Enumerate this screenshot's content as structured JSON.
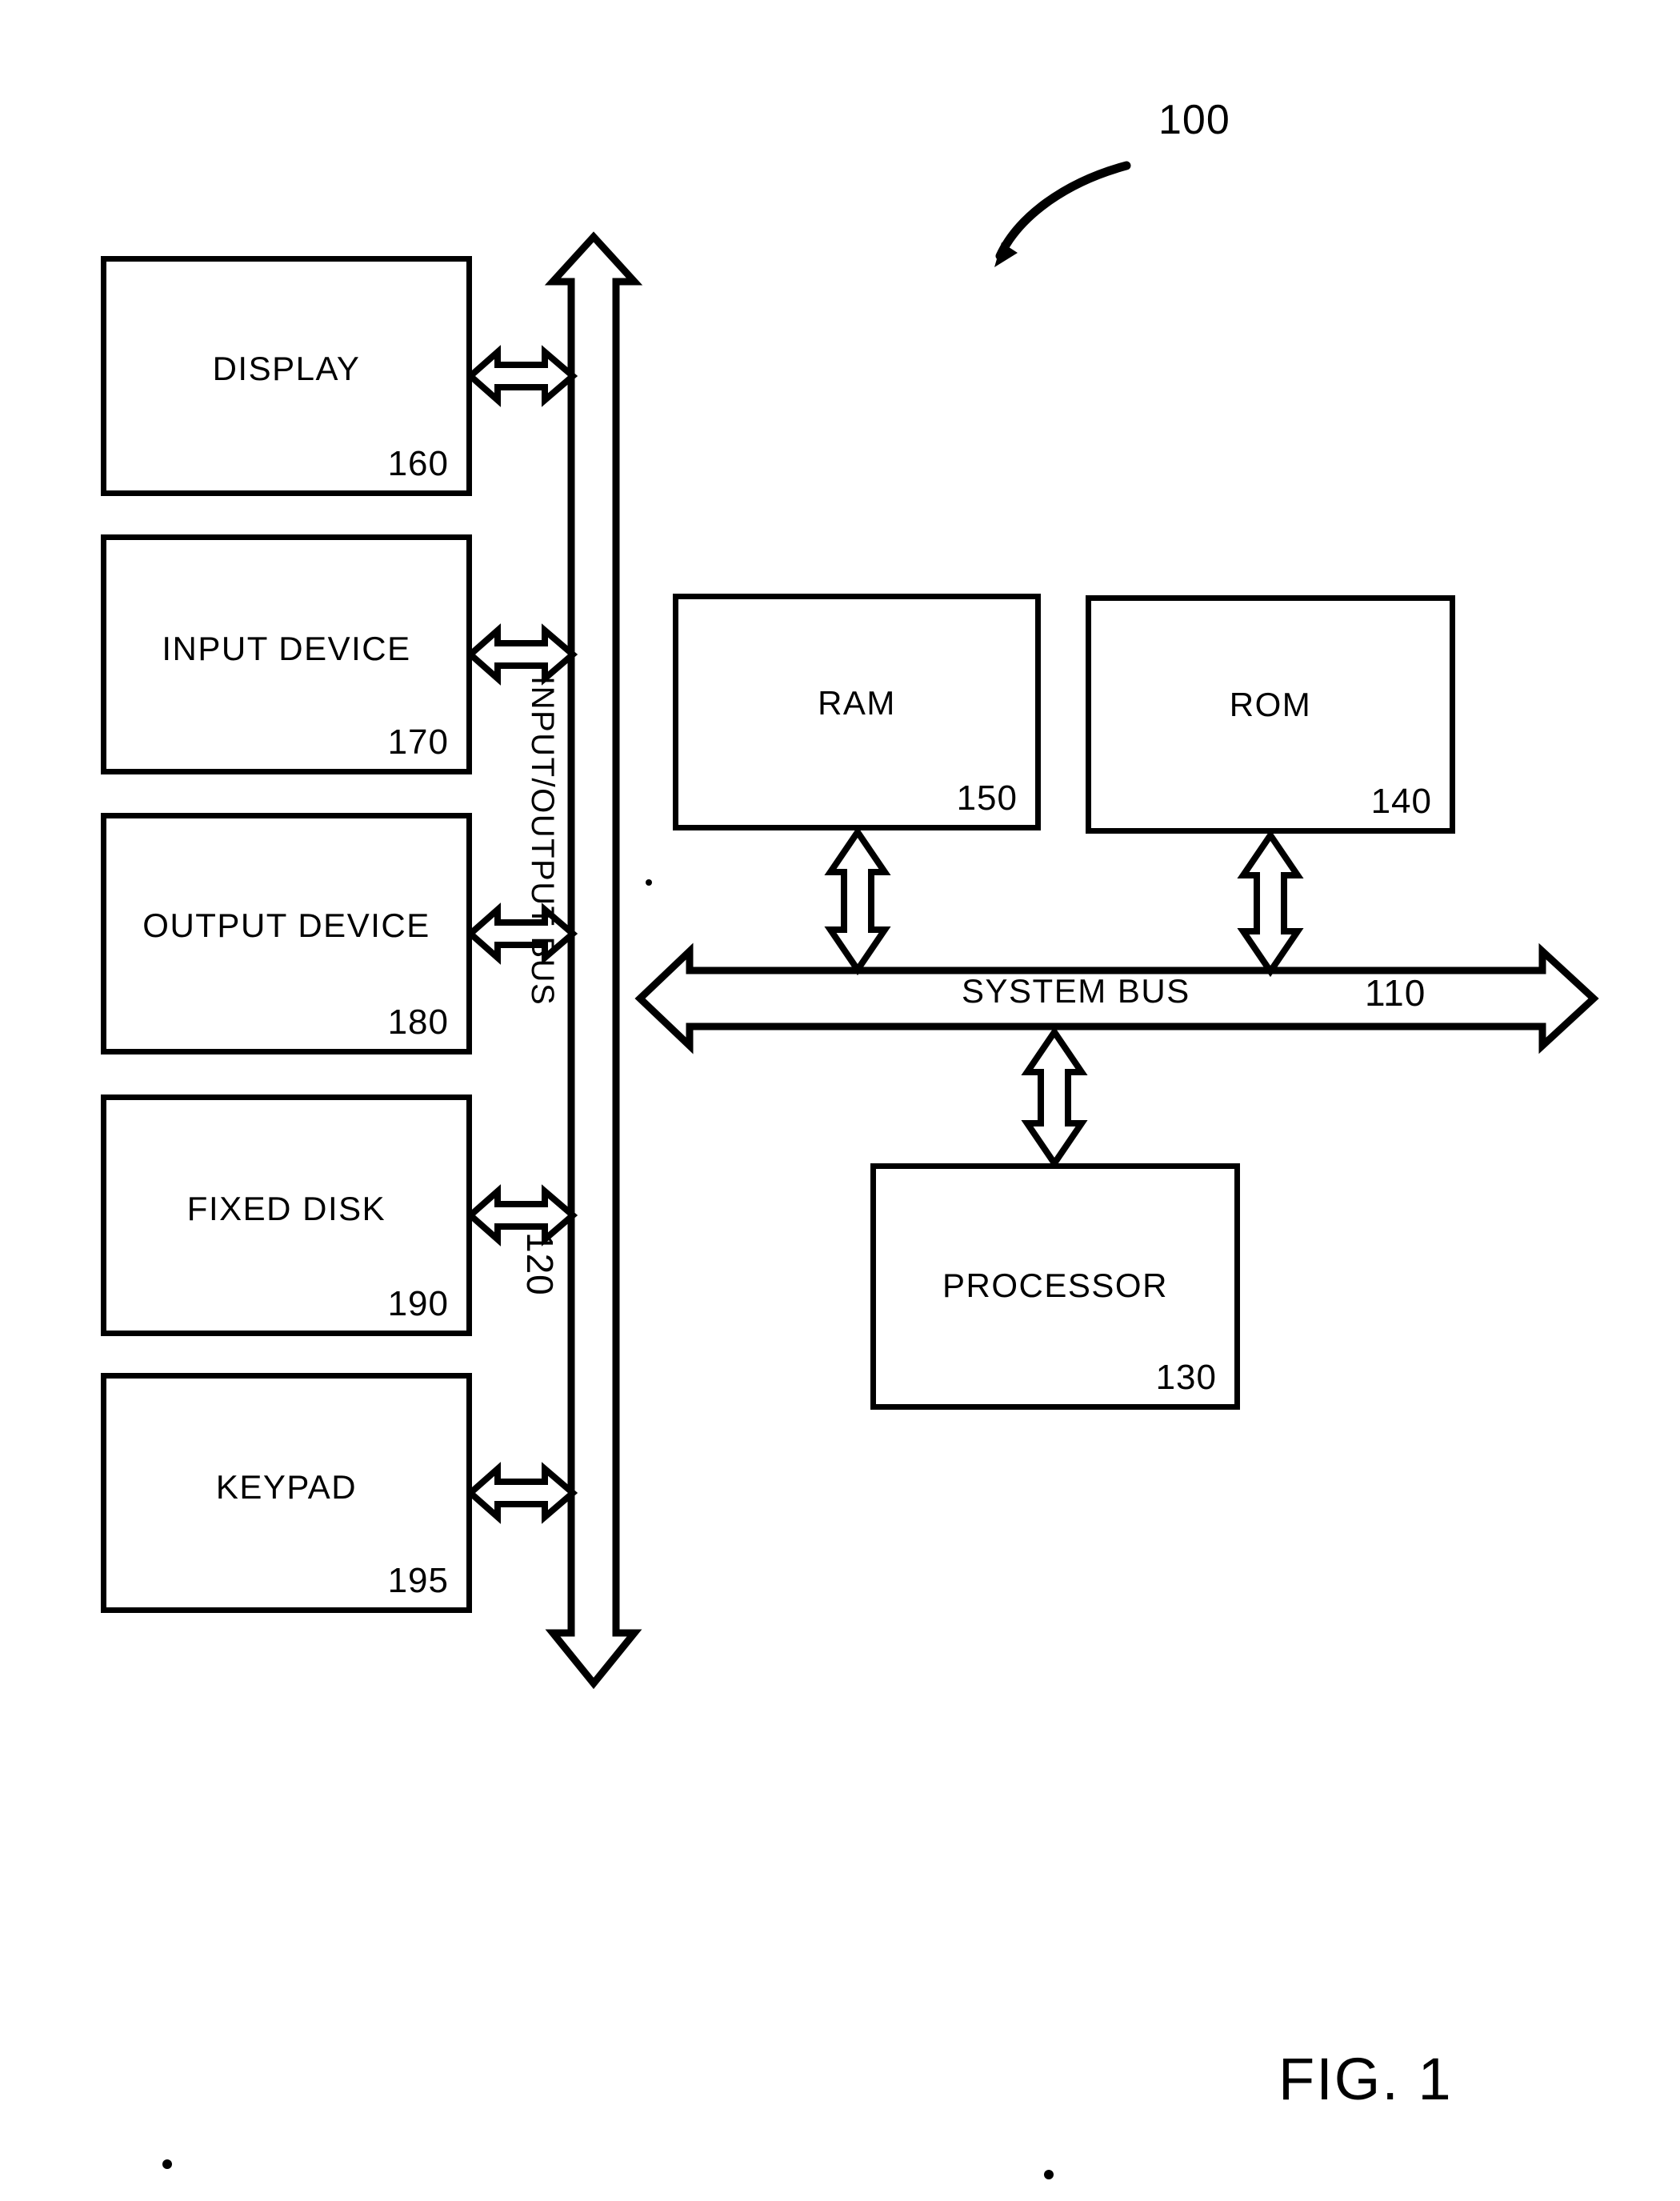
{
  "figure": {
    "caption": "FIG. 1",
    "system_ref": "100"
  },
  "blocks": [
    {
      "id": "display",
      "label": "DISPLAY",
      "ref": "160"
    },
    {
      "id": "input",
      "label": "INPUT DEVICE",
      "ref": "170"
    },
    {
      "id": "output",
      "label": "OUTPUT DEVICE",
      "ref": "180"
    },
    {
      "id": "fixeddisk",
      "label": "FIXED DISK",
      "ref": "190"
    },
    {
      "id": "keypad",
      "label": "KEYPAD",
      "ref": "195"
    },
    {
      "id": "ram",
      "label": "RAM",
      "ref": "150"
    },
    {
      "id": "rom",
      "label": "ROM",
      "ref": "140"
    },
    {
      "id": "processor",
      "label": "PROCESSOR",
      "ref": "130"
    }
  ],
  "buses": {
    "io_bus": {
      "label": "INPUT/OUTPUT BUS",
      "ref": "120",
      "orientation": "vertical"
    },
    "system_bus": {
      "label": "SYSTEM BUS",
      "ref": "110",
      "orientation": "horizontal"
    }
  },
  "connectors": [
    {
      "from": "display",
      "to": "io_bus",
      "type": "double-arrow",
      "orientation": "horizontal"
    },
    {
      "from": "input",
      "to": "io_bus",
      "type": "double-arrow",
      "orientation": "horizontal"
    },
    {
      "from": "output",
      "to": "io_bus",
      "type": "double-arrow",
      "orientation": "horizontal"
    },
    {
      "from": "fixeddisk",
      "to": "io_bus",
      "type": "double-arrow",
      "orientation": "horizontal"
    },
    {
      "from": "keypad",
      "to": "io_bus",
      "type": "double-arrow",
      "orientation": "horizontal"
    },
    {
      "from": "ram",
      "to": "system_bus",
      "type": "double-arrow",
      "orientation": "vertical"
    },
    {
      "from": "rom",
      "to": "system_bus",
      "type": "double-arrow",
      "orientation": "vertical"
    },
    {
      "from": "system_bus",
      "to": "processor",
      "type": "double-arrow",
      "orientation": "vertical"
    }
  ],
  "colors": {
    "ink": "#000000",
    "paper": "#ffffff"
  }
}
